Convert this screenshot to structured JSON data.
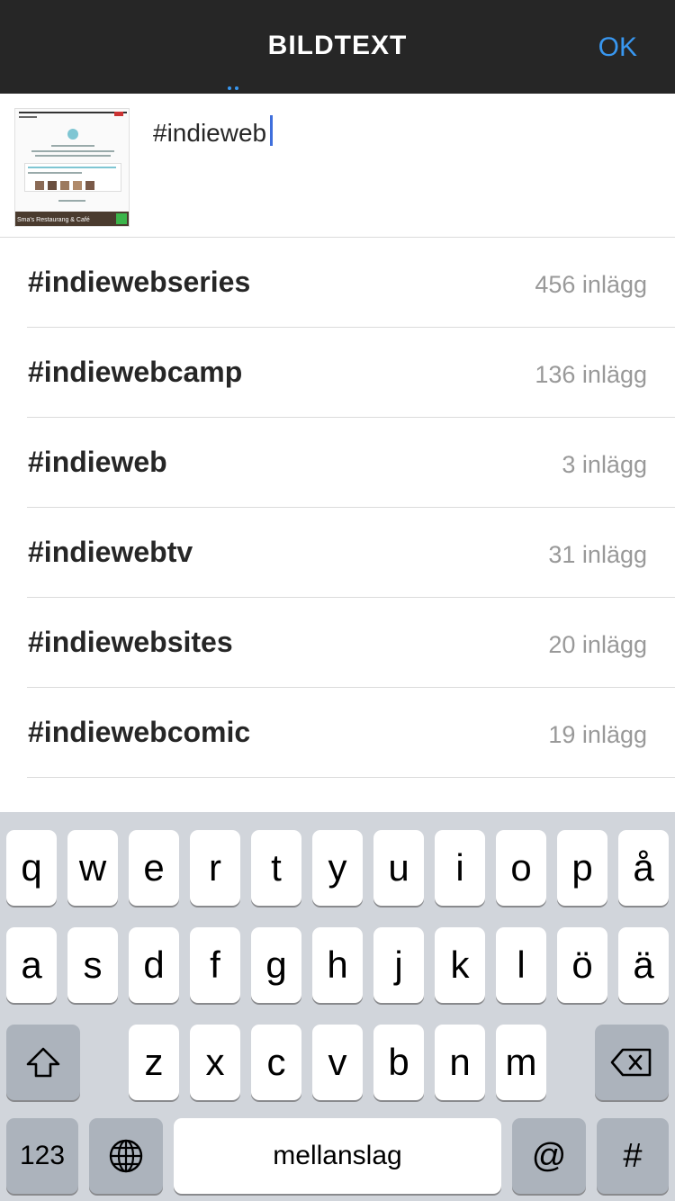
{
  "header": {
    "title": "BILDTEXT",
    "ok_label": "OK"
  },
  "caption": {
    "value": "#indieweb",
    "thumbnail_caption": "Sma's Restaurang & Café"
  },
  "suggestions": [
    {
      "tag": "#indiewebseries",
      "count": "456 inlägg"
    },
    {
      "tag": "#indiewebcamp",
      "count": "136 inlägg"
    },
    {
      "tag": "#indieweb",
      "count": "3 inlägg"
    },
    {
      "tag": "#indiewebtv",
      "count": "31 inlägg"
    },
    {
      "tag": "#indiewebsites",
      "count": "20 inlägg"
    },
    {
      "tag": "#indiewebcomic",
      "count": "19 inlägg"
    }
  ],
  "keyboard": {
    "row1": [
      "q",
      "w",
      "e",
      "r",
      "t",
      "y",
      "u",
      "i",
      "o",
      "p",
      "å"
    ],
    "row2": [
      "a",
      "s",
      "d",
      "f",
      "g",
      "h",
      "j",
      "k",
      "l",
      "ö",
      "ä"
    ],
    "row3": [
      "z",
      "x",
      "c",
      "v",
      "b",
      "n",
      "m"
    ],
    "numbers_label": "123",
    "space_label": "mellanslag",
    "at_label": "@",
    "hash_label": "#",
    "icons": {
      "shift": "shift-icon",
      "backspace": "backspace-icon",
      "globe": "globe-icon"
    }
  },
  "colors": {
    "header_bg": "#262626",
    "accent": "#3897f0",
    "keyboard_bg": "#d1d5db",
    "dark_key": "#acb3bc"
  }
}
